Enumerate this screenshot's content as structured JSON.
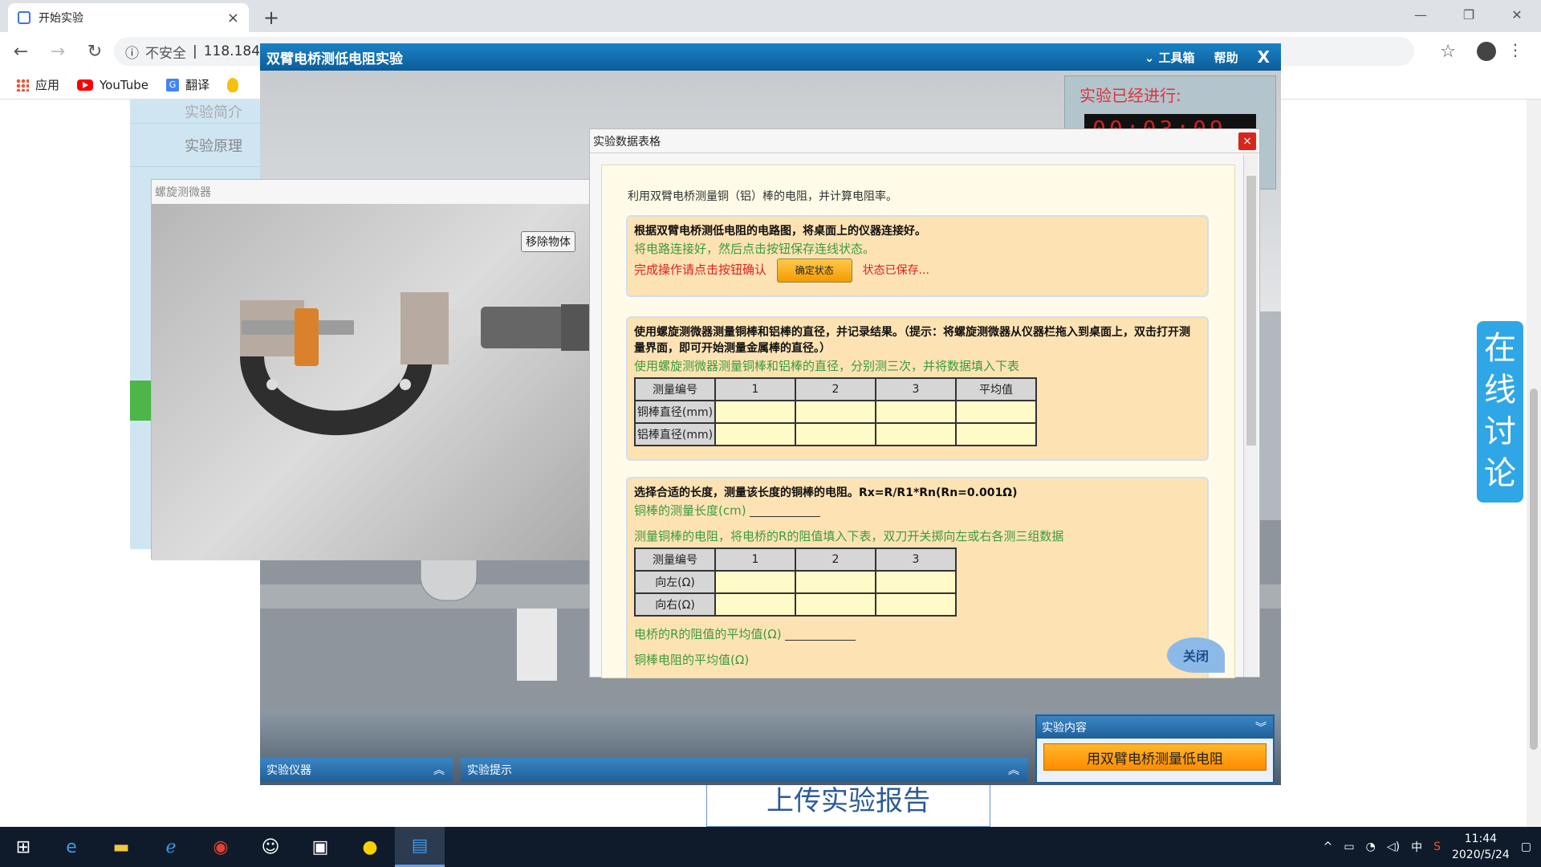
{
  "browser": {
    "tab_title": "开始实验",
    "address_warning": "不安全",
    "address_text": "118.184.",
    "bookmarks": [
      {
        "label": "应用",
        "icon": "apps-grid-icon"
      },
      {
        "label": "YouTube",
        "icon": "youtube-icon"
      },
      {
        "label": "翻译",
        "icon": "translate-icon"
      }
    ]
  },
  "page": {
    "left_menu": [
      "实验简介",
      "实验原理"
    ],
    "upload_label": "上传实验报告",
    "chat_label": "在线讨论"
  },
  "experiment": {
    "title": "双臂电桥测低电阻实验",
    "toolbox": "工具箱",
    "help": "帮助",
    "close": "X",
    "timer_label": "实验已经进行:",
    "timer_value": "00:03:09",
    "panels": {
      "instruments": "实验仪器",
      "hints": "实验提示",
      "content_title": "实验内容",
      "content_button": "用双臂电桥测量低电阻"
    }
  },
  "micrometer": {
    "title": "螺旋测微器",
    "remove_button": "移除物体"
  },
  "data_table": {
    "title": "实验数据表格",
    "close": "×",
    "intro": "利用双臂电桥测量铜（铝）棒的电阻，并计算电阻率。",
    "section1": {
      "bold": "根据双臂电桥测低电阻的电路图，将桌面上的仪器连接好。",
      "green": "将电路连接好，然后点击按钮保存连线状态。",
      "red_prefix": "完成操作请点击按钮确认",
      "confirm_button": "确定状态",
      "saved": "状态已保存..."
    },
    "section2": {
      "bold": "使用螺旋测微器测量铜棒和铝棒的直径，并记录结果。（提示：将螺旋测微器从仪器栏拖入到桌面上，双击打开测量界面，即可开始测量金属棒的直径。）",
      "green": "使用螺旋测微器测量铜棒和铝棒的直径，分别测三次，并将数据填入下表",
      "headers": [
        "测量编号",
        "1",
        "2",
        "3",
        "平均值"
      ],
      "rows": [
        "铜棒直径(mm)",
        "铝棒直径(mm)"
      ]
    },
    "section3": {
      "bold": "选择合适的长度，测量该长度的铜棒的电阻。Rx=R/R1*Rn(Rn=0.001Ω)",
      "length_label": "铜棒的测量长度(cm)",
      "green": "测量铜棒的电阻，将电桥的R的阻值填入下表，双刀开关掷向左或右各测三组数据",
      "headers": [
        "测量编号",
        "1",
        "2",
        "3"
      ],
      "rows": [
        "向左(Ω)",
        "向右(Ω)"
      ],
      "avg_label": "电桥的R的阻值的平均值(Ω)",
      "copper_label": "铜棒电阻的平均值(Ω)"
    },
    "close_badge": "关闭"
  },
  "taskbar": {
    "time": "11:44",
    "date": "2020/5/24",
    "ime": "中"
  }
}
